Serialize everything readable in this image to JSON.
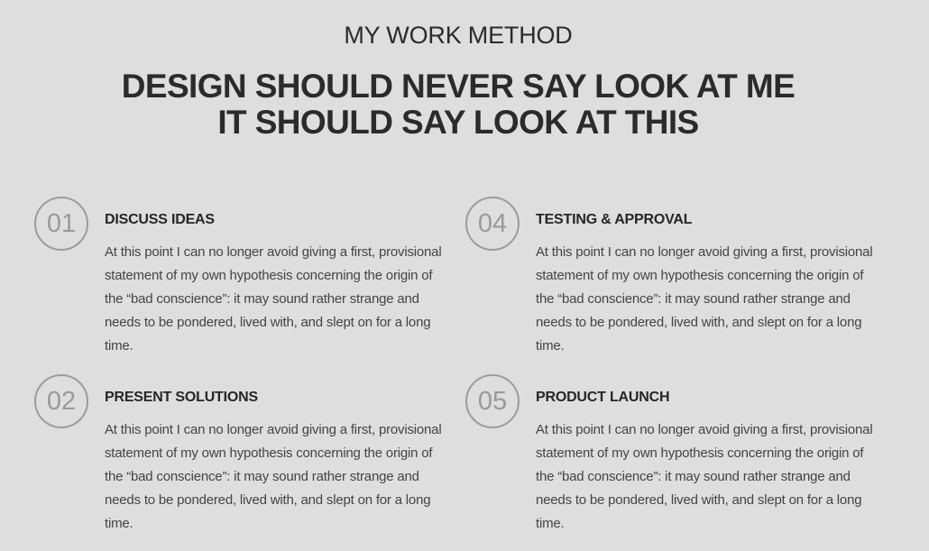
{
  "header": {
    "subtitle": "MY WORK METHOD",
    "headline_line1": "DESIGN SHOULD NEVER SAY LOOK AT ME",
    "headline_line2": "IT SHOULD SAY LOOK AT THIS"
  },
  "steps": [
    {
      "number": "01",
      "title": "DISCUSS IDEAS",
      "text": "At this point I can no longer avoid giving a first, provisional statement of my own hypothesis concerning the origin of the “bad conscience”: it may sound rather strange and needs to be pondered, lived with, and slept on for a long time."
    },
    {
      "number": "04",
      "title": "TESTING & APPROVAL",
      "text": "At this point I can no longer avoid giving a first, provisional statement of my own hypothesis concerning the origin of the “bad conscience”: it may sound rather strange and needs to be pondered, lived with, and slept on for a long time."
    },
    {
      "number": "02",
      "title": "PRESENT SOLUTIONS",
      "text": "At this point I can no longer avoid giving a first, provisional statement of my own hypothesis concerning the origin of the “bad conscience”: it may sound rather strange and needs to be pondered, lived with, and slept on for a long time."
    },
    {
      "number": "05",
      "title": "PRODUCT LAUNCH",
      "text": "At this point I can no longer avoid giving a first, provisional statement of my own hypothesis concerning the origin of the “bad conscience”: it may sound rather strange and needs to be pondered, lived with, and slept on for a long time."
    }
  ]
}
